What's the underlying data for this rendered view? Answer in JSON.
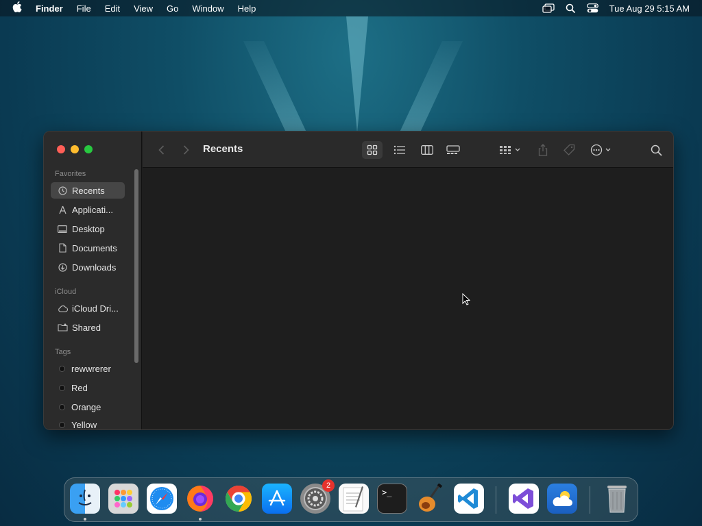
{
  "menubar": {
    "app_name": "Finder",
    "items": [
      "File",
      "Edit",
      "View",
      "Go",
      "Window",
      "Help"
    ],
    "clock": "Tue Aug 29  5:15 AM"
  },
  "window": {
    "title": "Recents",
    "sidebar": {
      "favorites_label": "Favorites",
      "favorites": [
        {
          "label": "Recents",
          "icon": "clock-icon",
          "active": true
        },
        {
          "label": "Applicati...",
          "icon": "applications-icon"
        },
        {
          "label": "Desktop",
          "icon": "desktop-icon"
        },
        {
          "label": "Documents",
          "icon": "document-icon"
        },
        {
          "label": "Downloads",
          "icon": "download-icon"
        }
      ],
      "icloud_label": "iCloud",
      "icloud": [
        {
          "label": "iCloud Dri...",
          "icon": "cloud-icon"
        },
        {
          "label": "Shared",
          "icon": "shared-folder-icon"
        }
      ],
      "tags_label": "Tags",
      "tags": [
        "rewwrerer",
        "Red",
        "Orange",
        "Yellow"
      ]
    }
  },
  "dock": {
    "apps": [
      "Finder",
      "Launchpad",
      "Safari",
      "Firefox",
      "Chrome",
      "App Store",
      "System Settings",
      "TextEdit",
      "Terminal",
      "GarageBand",
      "Visual Studio Code",
      "Visual Studio",
      "Weather",
      "Trash"
    ],
    "settings_badge": "2",
    "terminal_prompt": ">_"
  },
  "colors": {
    "close": "#ff5f57",
    "minimize": "#febc2e",
    "zoom": "#28c840",
    "badge": "#e5322d"
  }
}
